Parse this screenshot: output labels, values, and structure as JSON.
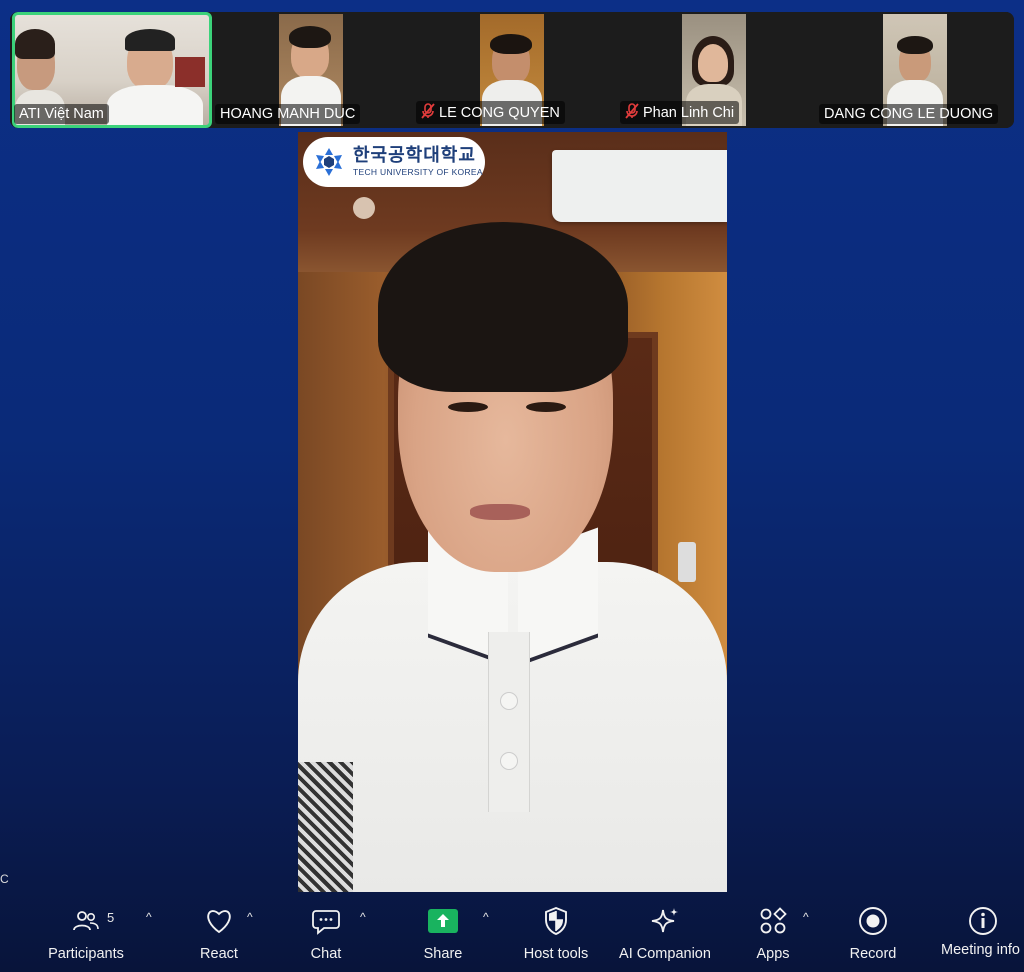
{
  "gallery": {
    "tiles": [
      {
        "name": "ATI Việt Nam",
        "muted": false,
        "active": true
      },
      {
        "name": "HOANG MANH DUC",
        "muted": false,
        "active": false
      },
      {
        "name": "LE CONG QUYEN",
        "muted": true,
        "active": false
      },
      {
        "name": "Phan Linh Chi",
        "muted": true,
        "active": false
      },
      {
        "name": "DANG CONG LE DUONG",
        "muted": false,
        "active": false
      }
    ]
  },
  "main_video": {
    "logo_korean": "한국공학대학교",
    "logo_english": "TECH UNIVERSITY OF KOREA"
  },
  "left_edge_label": "C",
  "toolbar": {
    "participants_label": "Participants",
    "participants_count": "5",
    "react_label": "React",
    "chat_label": "Chat",
    "share_label": "Share",
    "host_tools_label": "Host tools",
    "ai_companion_label": "AI Companion",
    "apps_label": "Apps",
    "record_label": "Record",
    "meeting_info_label": "Meeting info",
    "caret": "^"
  },
  "colors": {
    "active_speaker_border": "#3bd27a",
    "muted_icon": "#e23c3c",
    "share_green": "#19b35f",
    "background_top": "#0c2f87"
  }
}
